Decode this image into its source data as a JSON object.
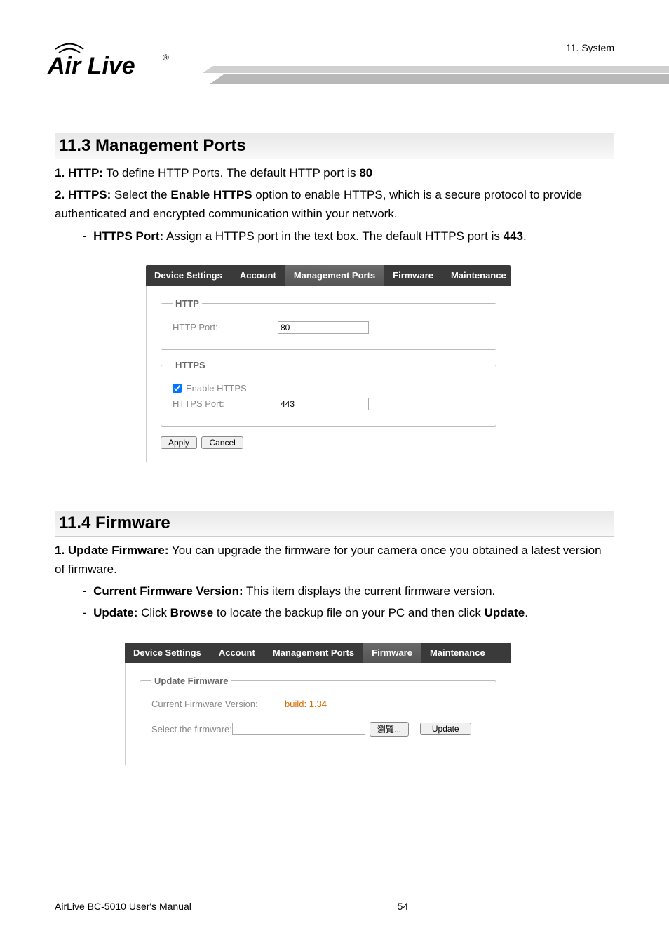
{
  "header": {
    "chapter": "11. System",
    "logo_text": "Air Live"
  },
  "section1": {
    "title": "11.3 Management Ports",
    "line1_label": "1. HTTP:",
    "line1_text": " To define HTTP Ports. The default HTTP port is ",
    "line1_bold": "80",
    "line2_label": "2. HTTPS:",
    "line2_a": " Select the ",
    "line2_b": "Enable HTTPS",
    "line2_c": " option to enable HTTPS, which is a secure protocol to provide authenticated and encrypted communication within your network.",
    "line3_label": "HTTPS Port:",
    "line3_text": " Assign a HTTPS port in the text box. The default HTTPS port is ",
    "line3_bold": "443",
    "line3_end": "."
  },
  "ui1": {
    "tabs": {
      "device": "Device Settings",
      "account": "Account",
      "ports": "Management Ports",
      "firmware": "Firmware",
      "maint": "Maintenance"
    },
    "http_legend": "HTTP",
    "http_port_label": "HTTP Port:",
    "http_port_value": "80",
    "https_legend": "HTTPS",
    "enable_https": "Enable HTTPS",
    "https_port_label": "HTTPS Port:",
    "https_port_value": "443",
    "apply": "Apply",
    "cancel": "Cancel"
  },
  "section2": {
    "title": "11.4 Firmware",
    "line1_label": "1. Update Firmware:",
    "line1_text": " You can upgrade the firmware for your camera once you obtained a latest version of firmware.",
    "line2_label": "Current Firmware Version:",
    "line2_text": " This item displays the current firmware version.",
    "line3_label": "Update:",
    "line3_a": " Click ",
    "line3_b": "Browse",
    "line3_c": " to locate the backup file on your PC and then click ",
    "line3_d": "Update",
    "line3_e": "."
  },
  "ui2": {
    "update_legend": "Update Firmware",
    "version_label": "Current Firmware Version:",
    "version_value": "build: 1.34",
    "select_label": "Select the firmware:",
    "browse": "瀏覽...",
    "update": "Update"
  },
  "footer": {
    "manual": "AirLive BC-5010 User's Manual",
    "page": "54"
  }
}
